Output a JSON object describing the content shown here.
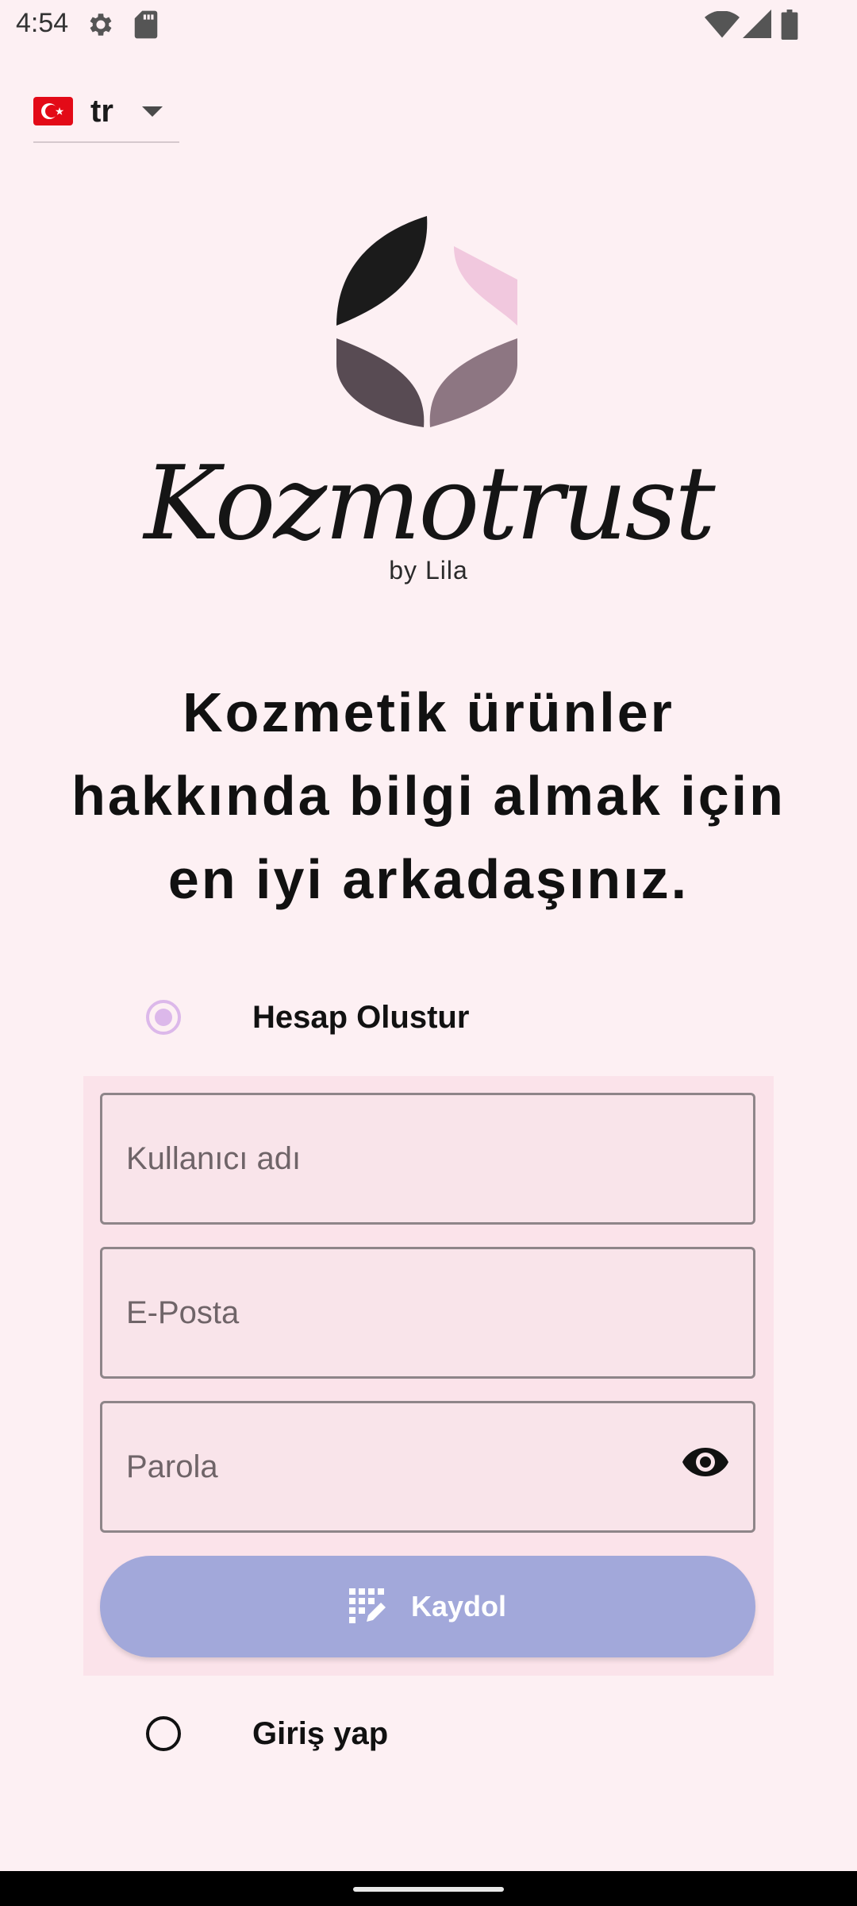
{
  "status_bar": {
    "time": "4:54",
    "icons": [
      "settings-icon",
      "sd-card-icon",
      "wifi-icon",
      "signal-icon",
      "battery-icon"
    ]
  },
  "language": {
    "flag": "turkey-flag-icon",
    "code": "tr"
  },
  "brand": {
    "name": "Kozmotrust",
    "subtitle": "by Lila",
    "colors": {
      "petal_black": "#1b1b1b",
      "petal_pink": "#f1c8de",
      "petal_dark": "#584b53",
      "petal_mauve": "#8d7682"
    }
  },
  "tagline": "Kozmetik ürünler hakkında bilgi almak için en iyi arkadaşınız.",
  "options": {
    "create_account": {
      "label": "Hesap Olustur",
      "selected": true
    },
    "login": {
      "label": "Giriş yap",
      "selected": false
    }
  },
  "form": {
    "username_placeholder": "Kullanıcı adı",
    "email_placeholder": "E-Posta",
    "password_placeholder": "Parola",
    "submit_label": "Kaydol"
  },
  "colors": {
    "background": "#fdf0f3",
    "panel": "#fbe3ea",
    "accent_radio": "#dcb8ea",
    "button": "#a2a8da"
  }
}
